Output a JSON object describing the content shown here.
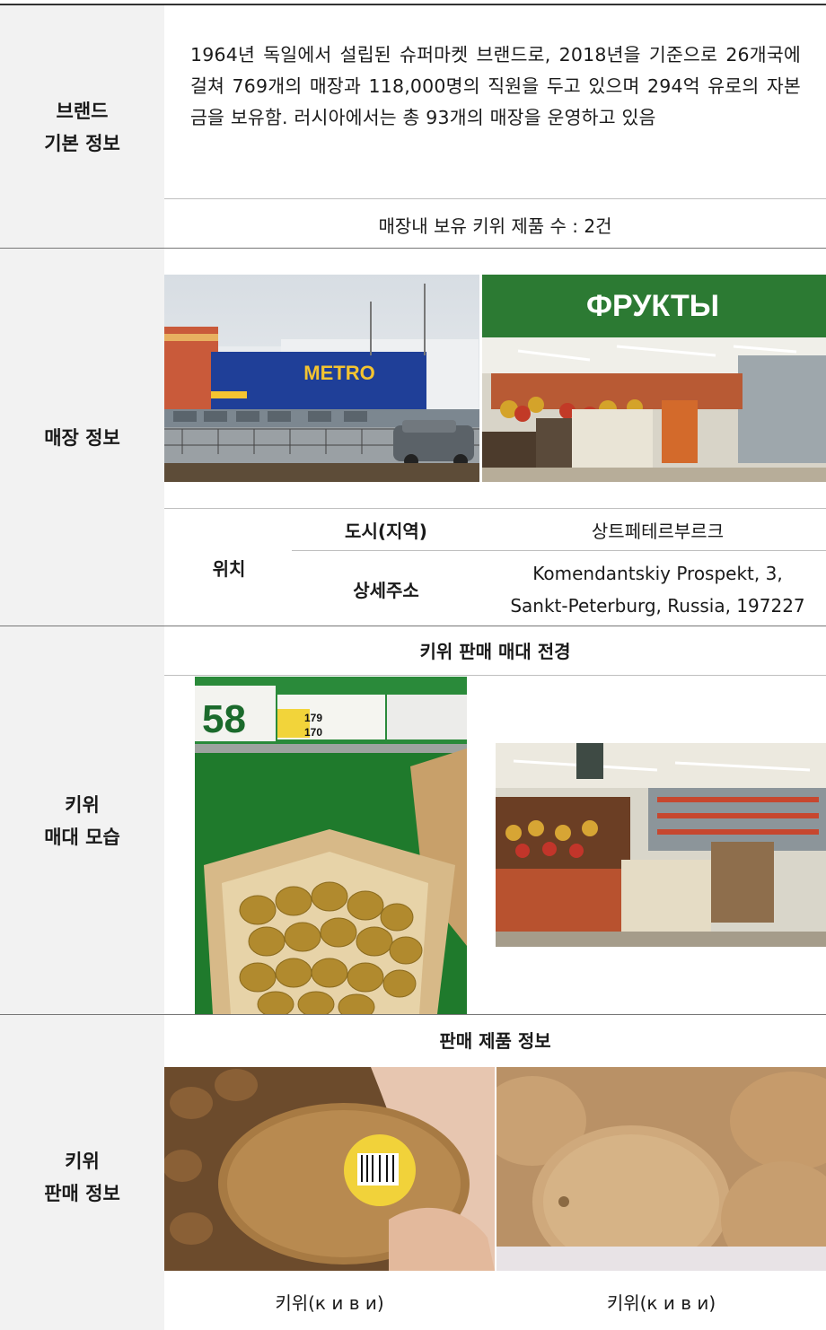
{
  "brand_info": {
    "label_line1": "브랜드",
    "label_line2": "기본 정보",
    "description": "1964년 독일에서 설립된 슈퍼마켓 브랜드로, 2018년을 기준으로 26개국에 걸쳐 769개의 매장과 118,000명의 직원을 두고 있으며 294억 유로의 자본금을 보유함. 러시아에서는 총 93개의 매장을 운영하고 있음",
    "kiwi_count": "매장내 보유 키위 제품 수 : 2건"
  },
  "store_info": {
    "label": "매장 정보",
    "sign_metro": "METRO",
    "sign_fruits": "ФРУКТЫ",
    "location_label": "위치",
    "city_label": "도시(지역)",
    "city_value": "상트페테르부르크",
    "address_label": "상세주소",
    "address_line1": "Komendantskiy Prospekt, 3,",
    "address_line2": "Sankt-Peterburg, Russia, 197227"
  },
  "kiwi_display": {
    "label_line1": "키위",
    "label_line2": "매대 모습",
    "header": "키위 판매 매대 전경",
    "shelf_number": "58",
    "price1": "179",
    "price2": "170"
  },
  "kiwi_sales": {
    "label_line1": "키위",
    "label_line2": "판매 정보",
    "header": "판매 제품 정보",
    "caption1": "키위(к и в и)",
    "caption2": "키위(к и в и)"
  }
}
